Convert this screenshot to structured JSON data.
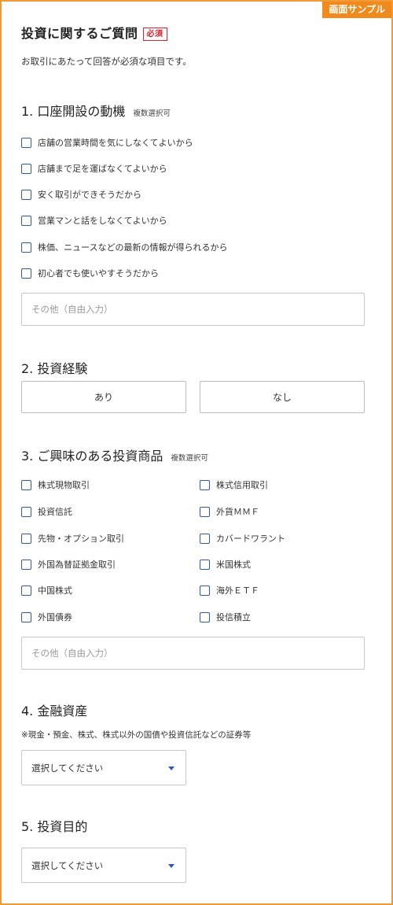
{
  "badge": "画面サンプル",
  "header": {
    "title": "投資に関するご質問",
    "required": "必須",
    "intro": "お取引にあたって回答が必須な項目です。"
  },
  "q1": {
    "heading": "1. 口座開設の動機",
    "note": "複数選択可",
    "options": [
      "店舗の営業時間を気にしなくてよいから",
      "店舗まで足を運ばなくてよいから",
      "安く取引ができそうだから",
      "営業マンと話をしなくてよいから",
      "株価、ニュースなどの最新の情報が得られるから",
      "初心者でも使いやすそうだから"
    ],
    "other_placeholder": "その他（自由入力）"
  },
  "q2": {
    "heading": "2. 投資経験",
    "yes": "あり",
    "no": "なし"
  },
  "q3": {
    "heading": "3. ご興味のある投資商品",
    "note": "複数選択可",
    "left": [
      "株式現物取引",
      "投資信託",
      "先物・オプション取引",
      "外国為替証拠金取引",
      "中国株式",
      "外国債券"
    ],
    "right": [
      "株式信用取引",
      "外貨ＭＭＦ",
      "カバードワラント",
      "米国株式",
      "海外ＥＴＦ",
      "投信積立"
    ],
    "other_placeholder": "その他（自由入力）"
  },
  "q4": {
    "heading": "4. 金融資産",
    "note": "※現金・預金、株式、株式以外の国債や投資信託などの証券等",
    "select": "選択してください"
  },
  "q5": {
    "heading": "5. 投資目的",
    "select": "選択してください"
  },
  "colors": {
    "accent": "#f29a38",
    "checkbox": "#2f5aa8",
    "required": "#d9232d"
  }
}
